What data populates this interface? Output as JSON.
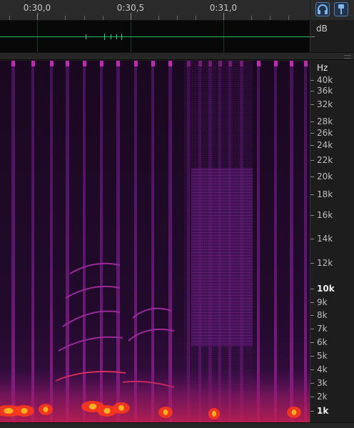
{
  "ruler": {
    "time_labels": [
      "0:30,0",
      "0:30,5",
      "0:31,0"
    ]
  },
  "toolbar": {
    "headphones_icon": "headphones-icon",
    "pin_icon": "pin-icon"
  },
  "waveform": {
    "scale_unit": "dB"
  },
  "spectrogram": {
    "unit_label": "Hz",
    "freq_labels": [
      "40k",
      "36k",
      "32k",
      "28k",
      "26k",
      "24k",
      "22k",
      "20k",
      "18k",
      "16k",
      "14k",
      "12k",
      "10k",
      "9k",
      "8k",
      "7k",
      "6k",
      "5k",
      "4k",
      "3k",
      "2k",
      "1k"
    ],
    "major_labels": [
      "10k",
      "1k"
    ],
    "colors": {
      "background": "#1a0a22",
      "band": "#5a1670",
      "bright": "#b0208a",
      "hot": "#ff3a1a",
      "core": "#ffb020"
    }
  }
}
